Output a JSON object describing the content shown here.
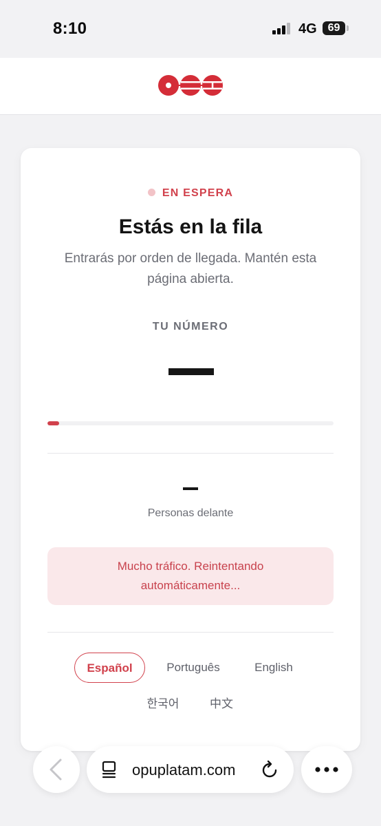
{
  "status_bar": {
    "time": "8:10",
    "network": "4G",
    "battery": "69"
  },
  "header": {
    "logo_icon": "brand-logo-icon"
  },
  "card": {
    "status_label": "EN ESPERA",
    "title": "Estás en la fila",
    "subtitle": "Entrarás por orden de llegada. Mantén esta página abierta.",
    "number_label": "TU NÚMERO",
    "progress_fraction": 0.04,
    "ahead_label": "Personas delante",
    "alert_text": "Mucho tráfico. Reintentando automáticamente...",
    "languages": [
      {
        "label": "Español",
        "active": true
      },
      {
        "label": "Português",
        "active": false
      },
      {
        "label": "English",
        "active": false
      },
      {
        "label": "한국어",
        "active": false
      },
      {
        "label": "中文",
        "active": false
      }
    ]
  },
  "browser": {
    "url": "opuplatam.com",
    "icons": [
      "back-icon",
      "tabs-icon",
      "reload-icon",
      "more-icon"
    ]
  },
  "colors": {
    "accent": "#d1414c",
    "alert_bg": "#fae8ea",
    "muted_text": "#6b6d75"
  }
}
